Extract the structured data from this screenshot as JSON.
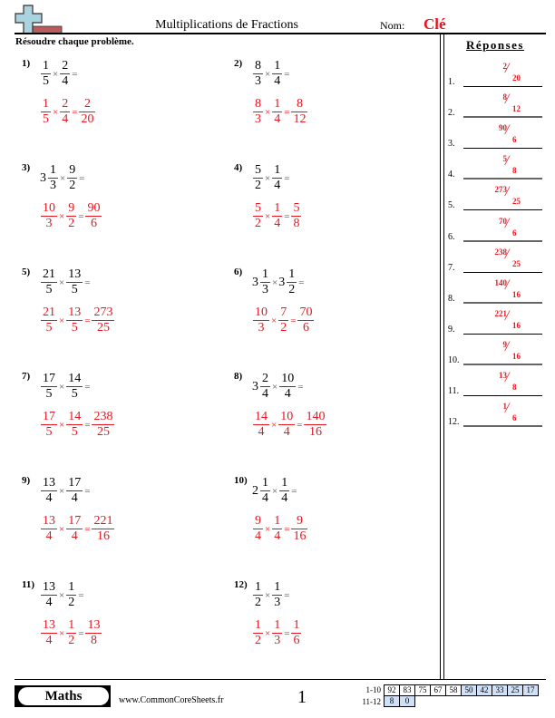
{
  "header": {
    "title": "Multiplications de Fractions",
    "name_label": "Nom:",
    "name_value": "Clé",
    "instructions": "Résoudre chaque problème.",
    "logo_icon": "plus-sign-logo-icon"
  },
  "problems": [
    {
      "label": "1)",
      "q": [
        {
          "w": "",
          "n": "1",
          "d": "5"
        },
        {
          "w": "",
          "n": "2",
          "d": "4"
        }
      ],
      "a": [
        {
          "n": "1",
          "d": "5"
        },
        {
          "n": "2",
          "d": "4"
        },
        {
          "n": "2",
          "d": "20"
        }
      ]
    },
    {
      "label": "2)",
      "q": [
        {
          "w": "",
          "n": "8",
          "d": "3"
        },
        {
          "w": "",
          "n": "1",
          "d": "4"
        }
      ],
      "a": [
        {
          "n": "8",
          "d": "3"
        },
        {
          "n": "1",
          "d": "4"
        },
        {
          "n": "8",
          "d": "12"
        }
      ]
    },
    {
      "label": "3)",
      "q": [
        {
          "w": "3",
          "n": "1",
          "d": "3"
        },
        {
          "w": "",
          "n": "9",
          "d": "2"
        }
      ],
      "a": [
        {
          "n": "10",
          "d": "3"
        },
        {
          "n": "9",
          "d": "2"
        },
        {
          "n": "90",
          "d": "6"
        }
      ]
    },
    {
      "label": "4)",
      "q": [
        {
          "w": "",
          "n": "5",
          "d": "2"
        },
        {
          "w": "",
          "n": "1",
          "d": "4"
        }
      ],
      "a": [
        {
          "n": "5",
          "d": "2"
        },
        {
          "n": "1",
          "d": "4"
        },
        {
          "n": "5",
          "d": "8"
        }
      ]
    },
    {
      "label": "5)",
      "q": [
        {
          "w": "",
          "n": "21",
          "d": "5"
        },
        {
          "w": "",
          "n": "13",
          "d": "5"
        }
      ],
      "a": [
        {
          "n": "21",
          "d": "5"
        },
        {
          "n": "13",
          "d": "5"
        },
        {
          "n": "273",
          "d": "25"
        }
      ]
    },
    {
      "label": "6)",
      "q": [
        {
          "w": "3",
          "n": "1",
          "d": "3"
        },
        {
          "w": "3",
          "n": "1",
          "d": "2"
        }
      ],
      "a": [
        {
          "n": "10",
          "d": "3"
        },
        {
          "n": "7",
          "d": "2"
        },
        {
          "n": "70",
          "d": "6"
        }
      ]
    },
    {
      "label": "7)",
      "q": [
        {
          "w": "",
          "n": "17",
          "d": "5"
        },
        {
          "w": "",
          "n": "14",
          "d": "5"
        }
      ],
      "a": [
        {
          "n": "17",
          "d": "5"
        },
        {
          "n": "14",
          "d": "5"
        },
        {
          "n": "238",
          "d": "25"
        }
      ]
    },
    {
      "label": "8)",
      "q": [
        {
          "w": "3",
          "n": "2",
          "d": "4"
        },
        {
          "w": "",
          "n": "10",
          "d": "4"
        }
      ],
      "a": [
        {
          "n": "14",
          "d": "4"
        },
        {
          "n": "10",
          "d": "4"
        },
        {
          "n": "140",
          "d": "16"
        }
      ]
    },
    {
      "label": "9)",
      "q": [
        {
          "w": "",
          "n": "13",
          "d": "4"
        },
        {
          "w": "",
          "n": "17",
          "d": "4"
        }
      ],
      "a": [
        {
          "n": "13",
          "d": "4"
        },
        {
          "n": "17",
          "d": "4"
        },
        {
          "n": "221",
          "d": "16"
        }
      ]
    },
    {
      "label": "10)",
      "q": [
        {
          "w": "2",
          "n": "1",
          "d": "4"
        },
        {
          "w": "",
          "n": "1",
          "d": "4"
        }
      ],
      "a": [
        {
          "n": "9",
          "d": "4"
        },
        {
          "n": "1",
          "d": "4"
        },
        {
          "n": "9",
          "d": "16"
        }
      ]
    },
    {
      "label": "11)",
      "q": [
        {
          "w": "",
          "n": "13",
          "d": "4"
        },
        {
          "w": "",
          "n": "1",
          "d": "2"
        }
      ],
      "a": [
        {
          "n": "13",
          "d": "4"
        },
        {
          "n": "1",
          "d": "2"
        },
        {
          "n": "13",
          "d": "8"
        }
      ]
    },
    {
      "label": "12)",
      "q": [
        {
          "w": "",
          "n": "1",
          "d": "2"
        },
        {
          "w": "",
          "n": "1",
          "d": "3"
        }
      ],
      "a": [
        {
          "n": "1",
          "d": "2"
        },
        {
          "n": "1",
          "d": "3"
        },
        {
          "n": "1",
          "d": "6"
        }
      ]
    }
  ],
  "operators": {
    "times": "×",
    "equals": "="
  },
  "answers": {
    "title": "Réponses",
    "items": [
      {
        "label": "1.",
        "n": "2",
        "d": "20"
      },
      {
        "label": "2.",
        "n": "8",
        "d": "12"
      },
      {
        "label": "3.",
        "n": "90",
        "d": "6"
      },
      {
        "label": "4.",
        "n": "5",
        "d": "8"
      },
      {
        "label": "5.",
        "n": "273",
        "d": "25"
      },
      {
        "label": "6.",
        "n": "70",
        "d": "6"
      },
      {
        "label": "7.",
        "n": "238",
        "d": "25"
      },
      {
        "label": "8.",
        "n": "140",
        "d": "16"
      },
      {
        "label": "9.",
        "n": "221",
        "d": "16"
      },
      {
        "label": "10.",
        "n": "9",
        "d": "16"
      },
      {
        "label": "11.",
        "n": "13",
        "d": "8"
      },
      {
        "label": "12.",
        "n": "1",
        "d": "6"
      }
    ]
  },
  "footer": {
    "subject": "Maths",
    "website": "www.CommonCoreSheets.fr",
    "page": "1",
    "score_rows": [
      {
        "label": "1-10",
        "scores": [
          "92",
          "83",
          "75",
          "67",
          "58",
          "50",
          "42",
          "33",
          "25",
          "17"
        ]
      },
      {
        "label": "11-12",
        "scores": [
          "8",
          "0"
        ]
      }
    ],
    "highlight_color": "#cfe0f7"
  },
  "colors": {
    "answer_red": "#e8141e"
  }
}
